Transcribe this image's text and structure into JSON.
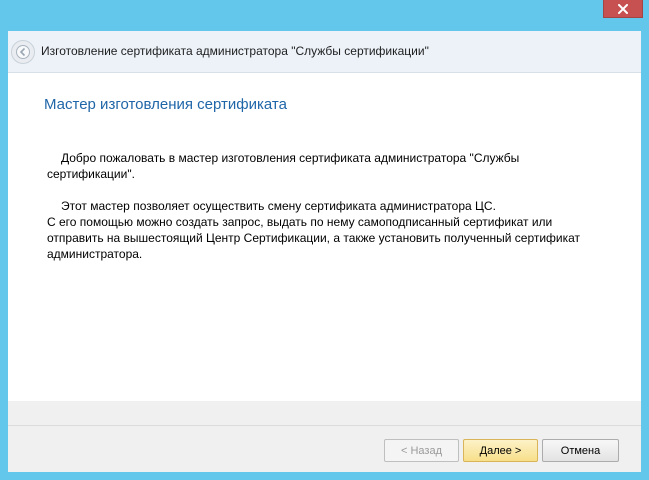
{
  "window": {
    "title": "Изготовление сертификата администратора \"Службы сертификации\"",
    "accent_color": "#63c6eb",
    "close_icon": "close-icon"
  },
  "wizard": {
    "heading": "Мастер изготовления сертификата",
    "paragraph1": "Добро пожаловать в мастер изготовления сертификата администратора \"Службы сертификации\".",
    "paragraph2_line1": "Этот мастер позволяет осуществить смену сертификата администратора ЦС.",
    "paragraph2_line2": "С его помощью можно создать запрос, выдать по нему самоподписанный сертификат или отправить на вышестоящий Центр Сертификации, а также установить полученный сертификат администратора."
  },
  "buttons": {
    "back": "< Назад",
    "next": "Далее >",
    "cancel": "Отмена"
  }
}
